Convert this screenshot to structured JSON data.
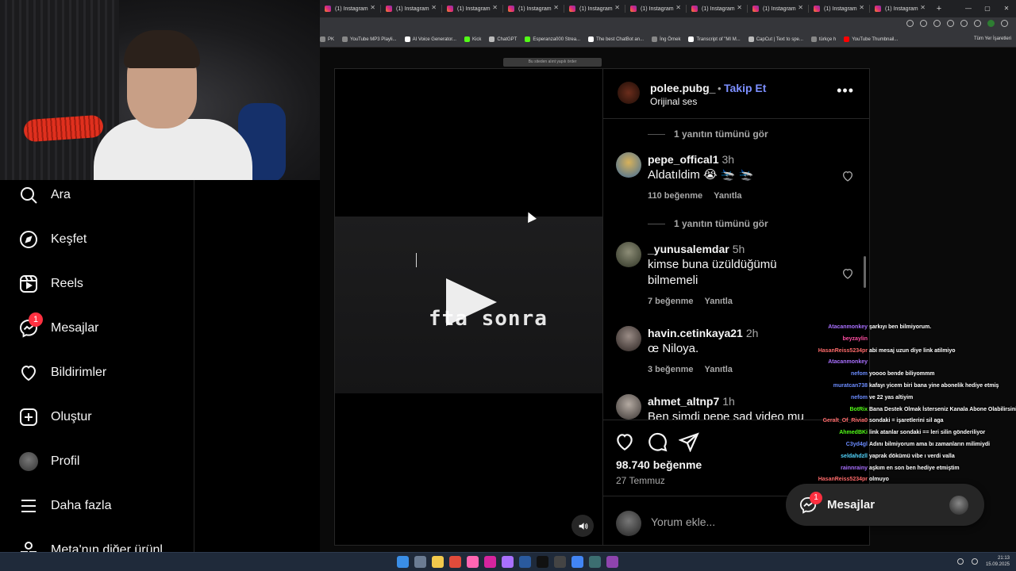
{
  "browser": {
    "tabs": [
      {
        "label": "(1) Instagram"
      },
      {
        "label": "(1) Instagram"
      },
      {
        "label": "(1) Instagram"
      },
      {
        "label": "(1) Instagram"
      },
      {
        "label": "(1) Instagram"
      },
      {
        "label": "(1) Instagram"
      },
      {
        "label": "(1) Instagram"
      },
      {
        "label": "(1) Instagram"
      },
      {
        "label": "(1) Instagram"
      },
      {
        "label": "(1) Instagram"
      }
    ],
    "tab_add": "+",
    "bookmarks": [
      {
        "label": "PK",
        "color": "#888888"
      },
      {
        "label": "YouTube MP3 Playli...",
        "color": "#888888"
      },
      {
        "label": "AI Voice Generator...",
        "color": "#ffffff"
      },
      {
        "label": "Kick",
        "color": "#53fc18"
      },
      {
        "label": "ChatGPT",
        "color": "#bbbbbb"
      },
      {
        "label": "Esperanza000 Strea...",
        "color": "#53fc18"
      },
      {
        "label": "The best ChatBot an...",
        "color": "#ffffff"
      },
      {
        "label": "İng Örnek",
        "color": "#888888"
      },
      {
        "label": "Transcript of \"MI M...",
        "color": "#ffffff"
      },
      {
        "label": "CapCut | Text to spe...",
        "color": "#bbbbbb"
      },
      {
        "label": "türkçe h",
        "color": "#888888"
      },
      {
        "label": "YouTube Thumbnail...",
        "color": "#ff0000"
      }
    ],
    "bookmarks_right": "Tüm Yer İşaretleri",
    "notice": "Bu siteden alınt yapılı örder"
  },
  "sidebar": {
    "items": [
      {
        "label": "Ara",
        "icon": "search-icon"
      },
      {
        "label": "Keşfet",
        "icon": "compass-icon"
      },
      {
        "label": "Reels",
        "icon": "reels-icon"
      },
      {
        "label": "Mesajlar",
        "icon": "messenger-icon",
        "badge": "1"
      },
      {
        "label": "Bildirimler",
        "icon": "heart-icon"
      },
      {
        "label": "Oluştur",
        "icon": "plus-square-icon"
      },
      {
        "label": "Profil",
        "icon": "avatar"
      },
      {
        "label": "Daha fazla",
        "icon": "menu-icon"
      },
      {
        "label": "Meta'nın diğer ürünl",
        "icon": "meta-apps-icon"
      }
    ]
  },
  "video": {
    "overlay_text": "fta sonra"
  },
  "post": {
    "owner": "polee.pubg_",
    "follow_label": "Takip Et",
    "audio": "Orijinal ses",
    "likes": "98.740 beğenme",
    "date": "27 Temmuz",
    "comment_placeholder": "Yorum ekle..."
  },
  "comments": {
    "reply_links": [
      {
        "label": "1 yanıtın tümünü gör"
      },
      {
        "label": "1 yanıtın tümünü gör"
      }
    ],
    "items": [
      {
        "user": "pepe_offical1",
        "time": "3h",
        "text": "Aldatıldim 😭 🛬 🛬",
        "likes": "110 beğenme",
        "reply": "Yanıtla"
      },
      {
        "user": "_yunusalemdar",
        "time": "5h",
        "text": "kimse buna üzüldüğümü bilmemeli",
        "likes": "7 beğenme",
        "reply": "Yanıtla"
      },
      {
        "user": "havin.cetinkaya21",
        "time": "2h",
        "text": "œ Niloya.",
        "likes": "3 beğenme",
        "reply": "Yanıtla"
      },
      {
        "user": "ahmet_altnp7",
        "time": "1h",
        "text": "Ben simdi pepe sad video mu"
      }
    ]
  },
  "chat": [
    {
      "user": "Atacanmonkey",
      "color": "#a970ff",
      "msg": "şarkıyı ben bilmiyorum."
    },
    {
      "user": "beyzaylin",
      "color": "#ff4fa3",
      "msg": ""
    },
    {
      "user": "HasanReiss5234pr",
      "color": "#ff6b6b",
      "msg": "abi mesaj uzun diye link atilmiyo"
    },
    {
      "user": "Atacanmonkey",
      "color": "#a970ff",
      "msg": ""
    },
    {
      "user": "nefom",
      "color": "#6b8cff",
      "msg": "yoooo bende biliyommm"
    },
    {
      "user": "muratcan738",
      "color": "#6b8cff",
      "msg": "kafayı yicem biri bana yine abonelik hediye etmiş"
    },
    {
      "user": "nefom",
      "color": "#6b8cff",
      "msg": "ve 22 yas altiyim"
    },
    {
      "user": "BotRix",
      "color": "#53fc18",
      "msg": "Bana Destek Olmak İsterseniz Kanala Abone Olabilirsiniz.."
    },
    {
      "user": "Geralt_Of_Rivia0",
      "color": "#ff6b6b",
      "msg": "sondaki = işaretlerini sil aga"
    },
    {
      "user": "AhmedBKi",
      "color": "#53fc18",
      "msg": "link atanlar sondaki == leri silin gönderiliyor"
    },
    {
      "user": "C3yd4gl",
      "color": "#6b8cff",
      "msg": "Adını bilmiyorum ama bı zamanların milimiydi"
    },
    {
      "user": "seldahdzll",
      "color": "#53d6ff",
      "msg": "yaprak dökümü vibe ı verdi valla"
    },
    {
      "user": "rainnrainy",
      "color": "#a970ff",
      "msg": "aşkım en son ben hediye etmiştim"
    },
    {
      "user": "HasanReiss5234pr",
      "color": "#ff6b6b",
      "msg": "olmuyo"
    }
  ],
  "messages_popup": {
    "label": "Mesajlar",
    "badge": "1"
  },
  "taskbar": {
    "time": "21:13",
    "date": "15.09.2025"
  },
  "colors": {
    "accent_link": "#7c8fff",
    "badge_red": "#ff3040",
    "bg": "#000000"
  }
}
